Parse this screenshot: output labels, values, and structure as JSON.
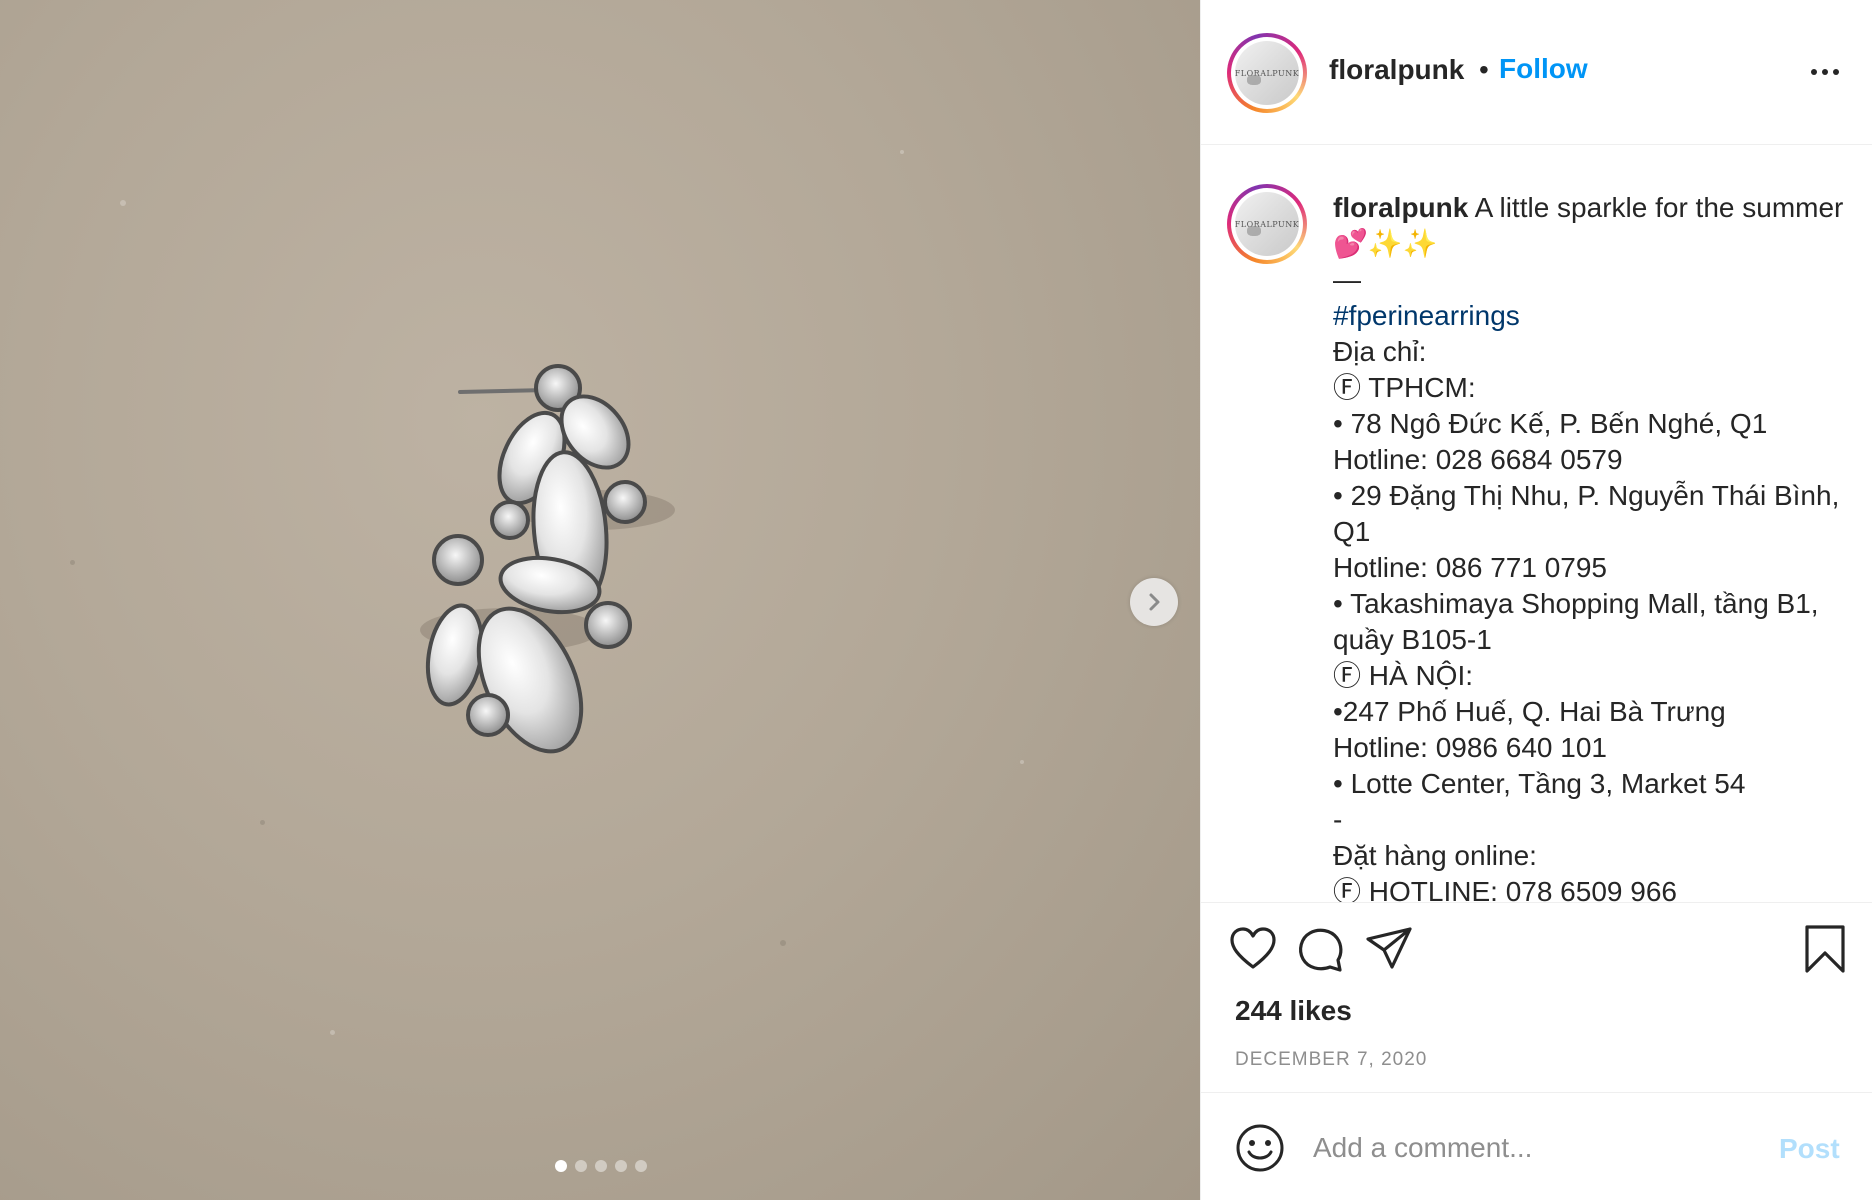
{
  "post": {
    "username": "floralpunk",
    "avatar_logo_text": "FLORALPUNK",
    "separator": "•",
    "follow_label": "Follow",
    "more_icon": "more-horizontal-icon"
  },
  "caption": {
    "username": "floralpunk",
    "text": " A little sparkle for the summer 💕✨✨\n—\n",
    "hashtag": "#fperinearrings",
    "body": "\nĐịa chỉ:\nⒻ TPHCM:\n• 78 Ngô Đức Kế, P. Bến Nghé, Q1\nHotline: 028 6684 0579\n• 29 Đặng Thị Nhu, P. Nguyễn Thái Bình, Q1\nHotline: 086 771 0795\n• Takashimaya Shopping Mall, tầng B1, quầy B105-1\nⒻ HÀ NỘI:\n•247 Phố Huế, Q. Hai Bà Trưng\nHotline: 0986 640 101\n• Lotte Center, Tầng 3, Market 54\n-\nĐặt hàng online:\nⒻ HOTLINE: 078 6509 966"
  },
  "media": {
    "slide_count": 5,
    "active_slide": 1,
    "next_icon": "chevron-right-icon"
  },
  "actions": {
    "icons": [
      "heart-icon",
      "comment-icon",
      "share-icon",
      "bookmark-icon"
    ],
    "likes": "244 likes",
    "date": "DECEMBER 7, 2020"
  },
  "comment": {
    "placeholder": "Add a comment...",
    "post_label": "Post",
    "emoji_icon": "emoji-icon"
  },
  "colors": {
    "link_blue": "#0095f6",
    "hashtag_blue": "#00376b",
    "post_disabled": "#b2dffc",
    "meta_gray": "#8e8e8e"
  }
}
